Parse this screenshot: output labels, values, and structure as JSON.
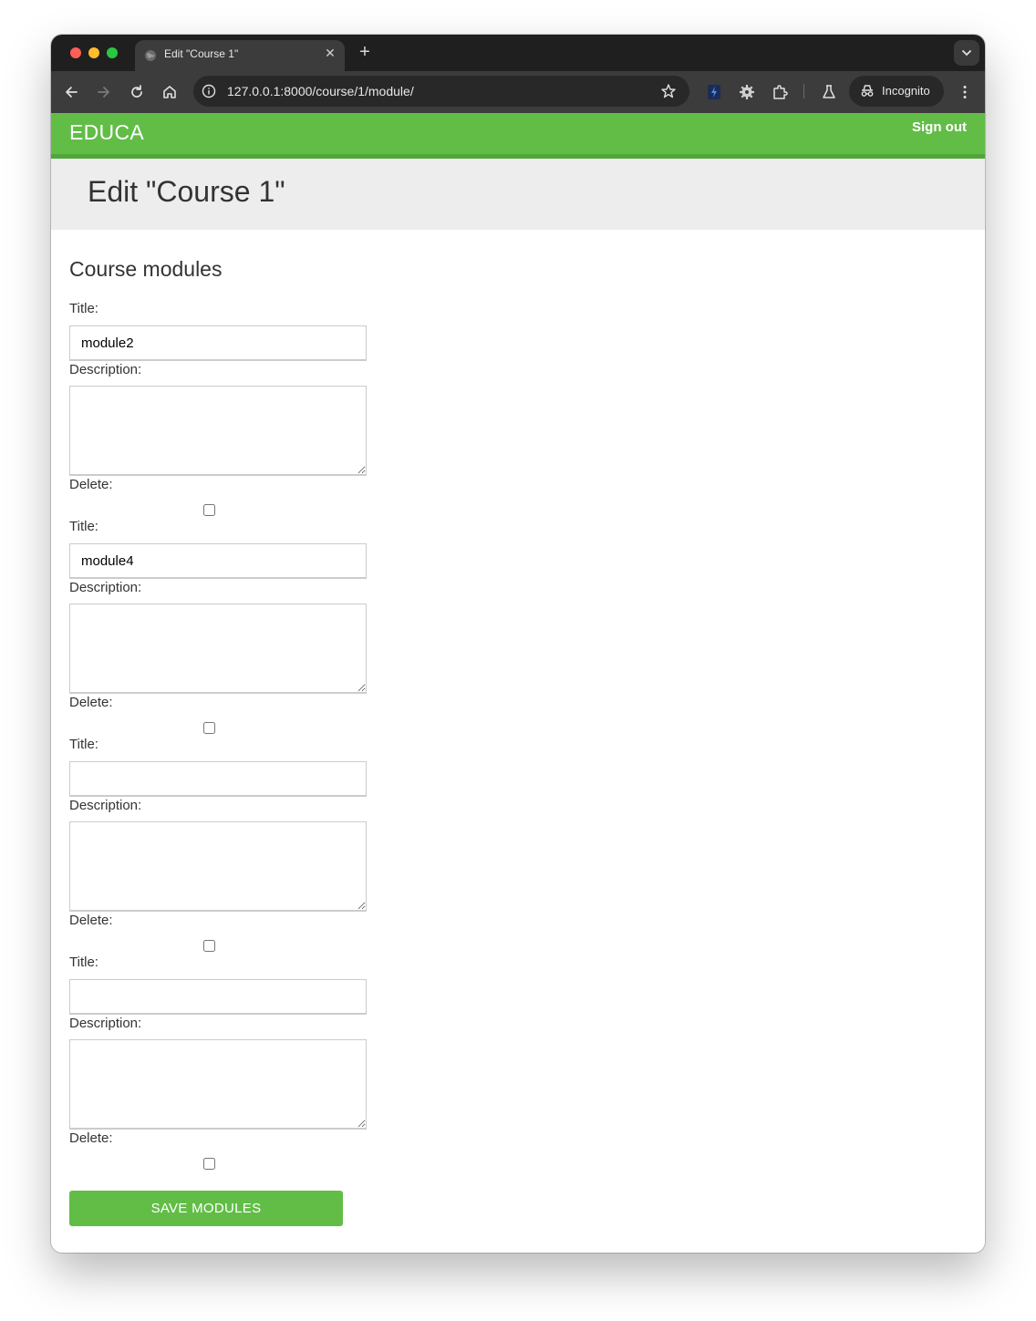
{
  "browser": {
    "tab_title": "Edit \"Course 1\"",
    "tab_close": "✕",
    "new_tab": "+",
    "url": "127.0.0.1:8000/course/1/module/",
    "incognito_label": "Incognito"
  },
  "site": {
    "logo": "EDUCA",
    "sign_out": "Sign out",
    "brand_color": "#62bd47"
  },
  "page": {
    "title": "Edit \"Course 1\"",
    "section_heading": "Course modules"
  },
  "labels": {
    "title": "Title:",
    "description": "Description:",
    "delete": "Delete:"
  },
  "modules": [
    {
      "title": "module2",
      "description": "",
      "delete": false
    },
    {
      "title": "module4",
      "description": "",
      "delete": false
    },
    {
      "title": "",
      "description": "",
      "delete": false
    },
    {
      "title": "",
      "description": "",
      "delete": false
    }
  ],
  "save_button": "SAVE MODULES"
}
